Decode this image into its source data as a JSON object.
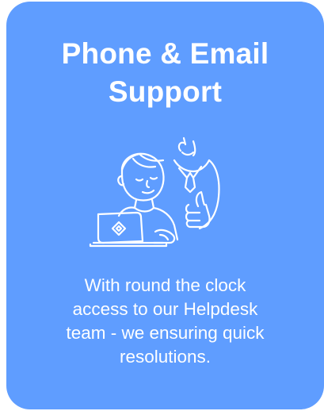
{
  "card": {
    "title_line1": "Phone & Email",
    "title_line2": "Support",
    "illustration_icon": "support-agents-illustration",
    "description_line1": "With round the clock",
    "description_line2": "access to our Helpdesk",
    "description_line3": "team - we ensuring quick",
    "description_line4": "resolutions.",
    "background_color": "#5f9dff",
    "text_color": "#ffffff"
  }
}
